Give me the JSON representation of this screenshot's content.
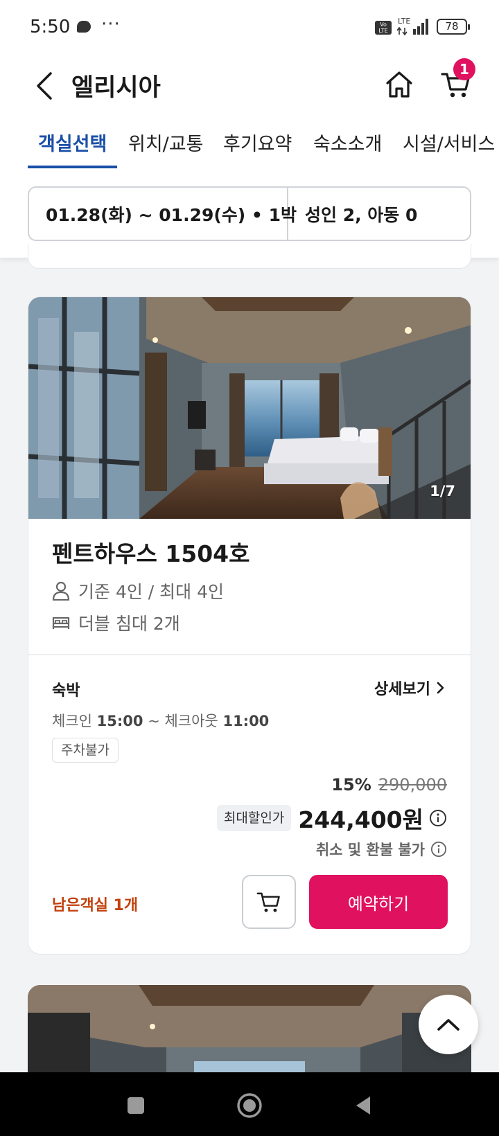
{
  "status_bar": {
    "time": "5:50",
    "dots": "···",
    "network": "LTE",
    "volte": "Vo LTE",
    "battery": "78"
  },
  "header": {
    "title": "엘리시아",
    "cart_count": "1"
  },
  "tabs": [
    {
      "label": "객실선택",
      "active": true
    },
    {
      "label": "위치/교통",
      "active": false
    },
    {
      "label": "후기요약",
      "active": false
    },
    {
      "label": "숙소소개",
      "active": false
    },
    {
      "label": "시설/서비스",
      "active": false
    }
  ],
  "search_summary": {
    "dates": "01.28(화) ~ 01.29(수) • 1박",
    "guests": "성인 2, 아동 0"
  },
  "room": {
    "photo_counter": "1/7",
    "name": "펜트하우스 1504호",
    "capacity": "기준 4인 / 최대 4인",
    "bed": "더블 침대 2개",
    "plan": {
      "title": "숙박",
      "detail_link": "상세보기",
      "checkin_label": "체크인",
      "checkin_time": "15:00",
      "checkout_label": "~ 체크아웃",
      "checkout_time": "11:00",
      "parking": "주차불가",
      "discount": "15%",
      "original_price": "290,000",
      "max_discount_label": "최대할인가",
      "final_price": "244,400원",
      "refund_policy": "취소 및 환불 불가",
      "remaining": "남은객실 1개",
      "book_label": "예약하기"
    }
  },
  "colors": {
    "accent_blue": "#1a4fa8",
    "brand_pink": "#e0115f",
    "remaining_orange": "#c2410c"
  }
}
